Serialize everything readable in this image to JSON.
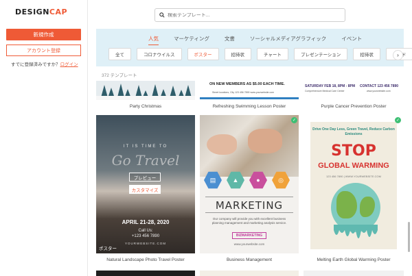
{
  "sidebar": {
    "logo_main": "DESIGN",
    "logo_accent": "CAP",
    "create_label": "新規作成",
    "register_label": "アカウント登録",
    "login_prompt": "すでに登録済みですか？",
    "login_link": "ログイン"
  },
  "search": {
    "placeholder": "検索テンプレート..."
  },
  "tabs": [
    {
      "label": "人気",
      "active": true
    },
    {
      "label": "マーケティング"
    },
    {
      "label": "文書"
    },
    {
      "label": "ソーシャルメディアグラフィック"
    },
    {
      "label": "イベント"
    }
  ],
  "chips": [
    {
      "label": "全て"
    },
    {
      "label": "コロナウイルス"
    },
    {
      "label": "ポスター",
      "active": true
    },
    {
      "label": "招待状"
    },
    {
      "label": "チャート"
    },
    {
      "label": "プレゼンテーション"
    },
    {
      "label": "招待状"
    },
    {
      "label": "カード"
    }
  ],
  "template_count": "372 テンプレート",
  "cards": [
    {
      "caption": "Party Christmas"
    },
    {
      "caption": "Refreshing Swimming Lesson Poster",
      "snippet_top": "ON NEW MEMBERS AS $5.00 EACH TIME.",
      "snippet_bottom": "Street locations, City   123 456 7890   www.yourwebsite.com"
    },
    {
      "caption": "Purple Cancer Prevention Poster",
      "snippet_left": "SATURDAY FEB 18, 8PM - 8PM",
      "snippet_left2": "Comprehensive Medical Care Center",
      "snippet_right": "CONTACT 123 456 7890",
      "snippet_right2": "www.yourwebsite.com"
    },
    {
      "caption": "Natural Landscape Photo Travel Poster",
      "kicker": "IT IS TIME TO",
      "headline": "Go Travel",
      "date": "APRIL 21-28, 2020",
      "call": "Call Us:",
      "phone": "+123 456 7890",
      "site": "YOURWEBSITE.COM",
      "tag": "ポスター",
      "preview_label": "プレビュー",
      "customize_label": "カスタマイズ"
    },
    {
      "caption": "Business Management",
      "title": "MARKETING",
      "desc": "Our company will provide you with excellent business planning management and marketing analysis service.",
      "tag": "BIZMARKETING",
      "site": "www.yourwebsite.com"
    },
    {
      "caption": "Melting Earth Global Warming Poster",
      "kicker": "Drive One Day Less, Green Travel, Reduce Carbon Emissions",
      "stop": "STOP",
      "headline": "GLOBAL WARMING",
      "small": "123 456 7890  |  WWW.YOURWEBSITE.COM"
    }
  ],
  "colors": {
    "accent": "#ef5a36",
    "category_bg": "#dff0f7",
    "premium_badge": "#3dbf73"
  }
}
